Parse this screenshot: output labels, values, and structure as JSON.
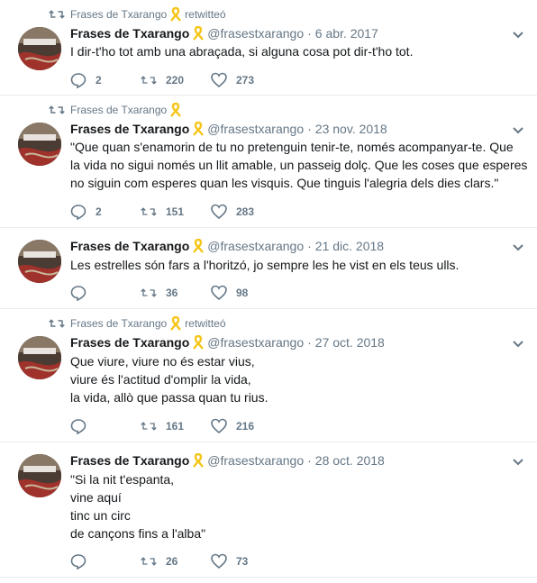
{
  "tweets": [
    {
      "retweet_by": "Frases de Txarango",
      "retweet_label": "retwitteó",
      "name": "Frases de Txarango",
      "handle": "@frasestxarango",
      "dot": "·",
      "time": "6 abr. 2017",
      "lines": [
        "I dir-t'ho tot amb una abraçada, si alguna cosa pot dir-t'ho tot."
      ],
      "replies": "2",
      "retweets": "220",
      "likes": "273"
    },
    {
      "retweet_by": "Frases de Txarango",
      "name": "Frases de Txarango",
      "handle": "@frasestxarango",
      "dot": "·",
      "time": "23 nov. 2018",
      "lines": [
        "\"Que quan s'enamorin de tu no pretenguin tenir-te, només acompanyar-te. Que",
        "la vida no sigui només un llit amable, un passeig dolç. Que les coses que esperes",
        "no siguin com esperes quan les visquis. Que tinguis l'alegria dels dies clars.\""
      ],
      "replies": "2",
      "retweets": "151",
      "likes": "283"
    },
    {
      "name": "Frases de Txarango",
      "handle": "@frasestxarango",
      "dot": "·",
      "time": "21 dic. 2018",
      "lines": [
        "Les estrelles són fars a l'horitzó, jo sempre les he vist en els teus ulls."
      ],
      "replies": "",
      "retweets": "36",
      "likes": "98"
    },
    {
      "retweet_by": "Frases de Txarango",
      "retweet_label": "retwitteó",
      "name": "Frases de Txarango",
      "handle": "@frasestxarango",
      "dot": "·",
      "time": "27 oct. 2018",
      "lines": [
        "Que viure, viure no és estar vius,",
        "viure és l'actitud d'omplir la vida,",
        "la vida, allò que passa quan tu rius."
      ],
      "replies": "",
      "retweets": "161",
      "likes": "216"
    },
    {
      "name": "Frases de Txarango",
      "handle": "@frasestxarango",
      "dot": "·",
      "time": "28 oct. 2018",
      "lines": [
        "\"Si la nit t'espanta,",
        "vine aquí",
        "tinc un circ",
        "de cançons fins a l'alba\""
      ],
      "replies": "",
      "retweets": "26",
      "likes": "73"
    }
  ],
  "icons": {
    "retweet": "retweet-icon",
    "reply": "reply-icon",
    "like": "heart-icon",
    "ribbon": "yellow-ribbon-icon",
    "caret": "chevron-down-icon"
  },
  "colors": {
    "text": "#14171a",
    "muted": "#657786",
    "divider": "#e6ecf0",
    "ribbon": "#f5c518"
  }
}
